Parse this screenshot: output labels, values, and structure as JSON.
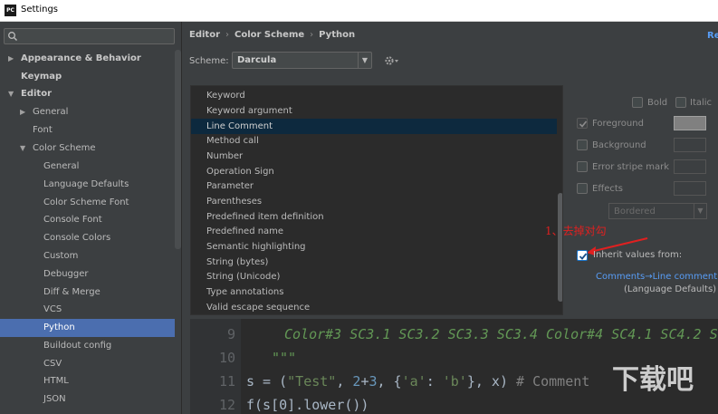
{
  "window": {
    "title": "Settings",
    "app_icon": "PC"
  },
  "search": {
    "placeholder": "Q▾"
  },
  "sidebar": {
    "items": [
      {
        "label": "Appearance & Behavior",
        "level": 0,
        "expanded": false,
        "bold": true
      },
      {
        "label": "Keymap",
        "level": 0,
        "bold": true
      },
      {
        "label": "Editor",
        "level": 0,
        "expanded": true,
        "bold": true
      },
      {
        "label": "General",
        "level": 1,
        "expanded": false
      },
      {
        "label": "Font",
        "level": 1
      },
      {
        "label": "Color Scheme",
        "level": 1,
        "expanded": true
      },
      {
        "label": "General",
        "level": 2
      },
      {
        "label": "Language Defaults",
        "level": 2
      },
      {
        "label": "Color Scheme Font",
        "level": 2
      },
      {
        "label": "Console Font",
        "level": 2
      },
      {
        "label": "Console Colors",
        "level": 2
      },
      {
        "label": "Custom",
        "level": 2
      },
      {
        "label": "Debugger",
        "level": 2
      },
      {
        "label": "Diff & Merge",
        "level": 2
      },
      {
        "label": "VCS",
        "level": 2
      },
      {
        "label": "Python",
        "level": 2,
        "selected": true
      },
      {
        "label": "Buildout config",
        "level": 2
      },
      {
        "label": "CSV",
        "level": 2
      },
      {
        "label": "HTML",
        "level": 2
      },
      {
        "label": "JSON",
        "level": 2
      }
    ]
  },
  "breadcrumb": [
    "Editor",
    "Color Scheme",
    "Python"
  ],
  "reset_link": "Re",
  "scheme": {
    "label": "Scheme:",
    "value": "Darcula"
  },
  "attributes": [
    "Keyword",
    "Keyword argument",
    "Line Comment",
    "Method call",
    "Number",
    "Operation Sign",
    "Parameter",
    "Parentheses",
    "Predefined item definition",
    "Predefined name",
    "Semantic highlighting",
    "String (bytes)",
    "String (Unicode)",
    "Type annotations",
    "Valid escape sequence"
  ],
  "selected_attribute": "Line Comment",
  "properties": {
    "bold": "Bold",
    "italic": "Italic",
    "foreground": "Foreground",
    "background": "Background",
    "error_stripe": "Error stripe mark",
    "effects": "Effects",
    "effects_value": "Bordered",
    "inherit": "Inherit values from:",
    "inherit_link": "Comments→Line comment",
    "inherit_sub": "(Language Defaults)",
    "foreground_checked": true,
    "inherit_checked": true
  },
  "annotation": "1、去掉对勾",
  "preview": {
    "lines": [
      {
        "num": "9",
        "text": "Color#3 SC3.1 SC3.2 SC3.3 SC3.4 Color#4 SC4.1 SC4.2 SC4"
      },
      {
        "num": "10",
        "text": "\"\"\""
      },
      {
        "num": "11",
        "parts": [
          "s = (",
          "\"Test\"",
          ", ",
          "2",
          "+",
          "3",
          ", {",
          "'a'",
          ": ",
          "'b'",
          "}, x)    ",
          "# Comment"
        ]
      },
      {
        "num": "12",
        "text": "f(s[0].lower())"
      }
    ]
  },
  "watermark": "下载吧",
  "colors": {
    "selection": "#4b6eaf",
    "list_selection": "#0d293e",
    "link": "#589df6",
    "annotation": "#e02020"
  }
}
